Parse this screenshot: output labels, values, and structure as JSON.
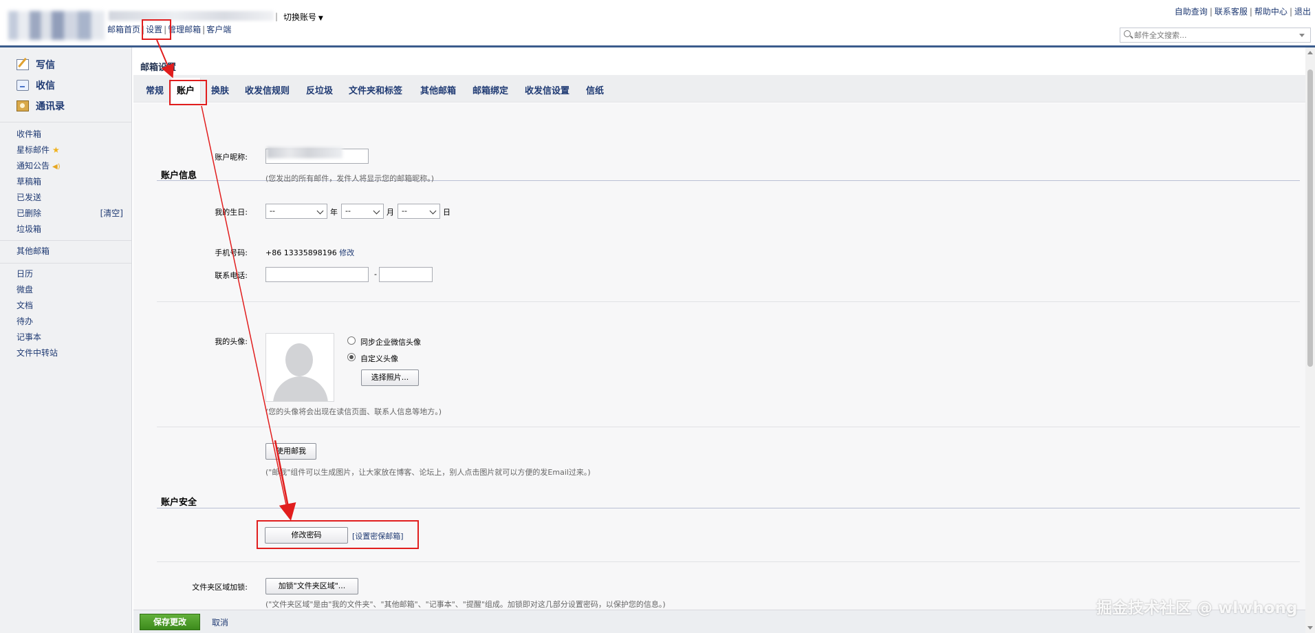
{
  "header": {
    "switch_account": "切换账号",
    "top_links": [
      "邮箱首页",
      "设置",
      "管理邮箱",
      "客户端"
    ],
    "right_links": [
      "自助查询",
      "联系客服",
      "帮助中心",
      "退出"
    ],
    "search_placeholder": "邮件全文搜索..."
  },
  "sidebar": {
    "main_items": [
      "写信",
      "收信",
      "通讯录"
    ],
    "folders": [
      "收件箱",
      "星标邮件",
      "通知公告",
      "草稿箱",
      "已发送",
      "已删除",
      "垃圾箱"
    ],
    "clear_label": "[清空]",
    "other_mailbox": "其他邮箱",
    "tools": [
      "日历",
      "微盘",
      "文档",
      "待办",
      "记事本",
      "文件中转站"
    ]
  },
  "page_title": "邮箱设置",
  "tabs": [
    "常规",
    "账户",
    "换肤",
    "收发信规则",
    "反垃圾",
    "文件夹和标签",
    "其他邮箱",
    "邮箱绑定",
    "收发信设置",
    "信纸"
  ],
  "active_tab": "账户",
  "account_info": {
    "section_title": "账户信息",
    "nickname_label": "账户昵称:",
    "nickname_hint": "(您发出的所有邮件，发件人将显示您的邮箱昵称。)",
    "birthday_label": "我的生日:",
    "birthday_default": "--",
    "year_unit": "年",
    "month_unit": "月",
    "day_unit": "日",
    "mobile_label": "手机号码:",
    "mobile_value": "+86 13335898196",
    "mobile_edit": "修改",
    "phone_label": "联系电话:",
    "phone_dash": "-",
    "avatar_label": "我的头像:",
    "avatar_sync_option": "同步企业微信头像",
    "avatar_custom_option": "自定义头像",
    "choose_photo_button": "选择照片...",
    "avatar_hint": "(您的头像将会出现在读信页面、联系人信息等地方。)",
    "mail_me_button": "使用邮我",
    "mail_me_hint": "(\"邮我\"组件可以生成图片，让大家放在博客、论坛上，别人点击图片就可以方便的发Email过来。)"
  },
  "account_security": {
    "section_title": "账户安全",
    "change_password_button": "修改密码",
    "set_secure_mailbox_link": "[设置密保邮箱]",
    "folder_lock_label": "文件夹区域加锁:",
    "folder_lock_button": "加锁\"文件夹区域\"...",
    "folder_lock_hint": "(\"文件夹区域\"是由\"我的文件夹\"、\"其他邮箱\"、\"记事本\"、\"提醒\"组成。加锁即对这几部分设置密码，以保护您的信息。)"
  },
  "footer": {
    "save_button": "保存更改",
    "cancel_link": "取消"
  },
  "watermark": "掘金技术社区 @ wlwhong",
  "colors": {
    "accent_blue": "#1f3a73",
    "annotation_red": "#e11d1d",
    "save_green": "#4a9a26"
  }
}
